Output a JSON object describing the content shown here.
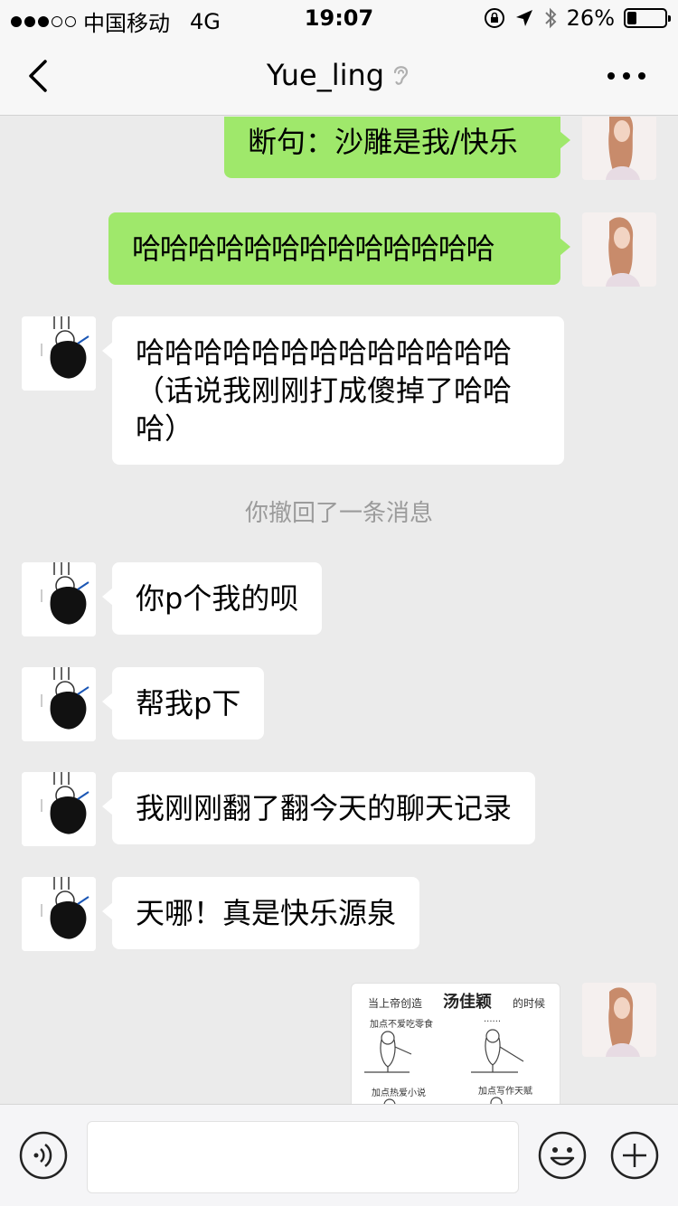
{
  "status_bar": {
    "carrier": "中国移动",
    "network": "4G",
    "time": "19:07",
    "battery": "26%",
    "battery_level": 0.26,
    "signal_bars": 3,
    "signal_total": 5,
    "icons": [
      "rotation-lock-icon",
      "location-arrow-icon",
      "bluetooth-icon",
      "battery-icon"
    ]
  },
  "nav": {
    "title": "Yue_ling",
    "back_icon": "chevron-left-icon",
    "title_icon": "ear-icon",
    "more_icon": "more-dots-icon"
  },
  "messages": [
    {
      "from": "me",
      "text": "断句：沙雕是我/快乐"
    },
    {
      "from": "me",
      "text": "哈哈哈哈哈哈哈哈哈哈哈哈哈"
    },
    {
      "from": "them",
      "text": "哈哈哈哈哈哈哈哈哈哈哈哈哈（话说我刚刚打成傻掉了哈哈哈）"
    },
    {
      "from": "system",
      "text": "你撤回了一条消息"
    },
    {
      "from": "them",
      "text": "你p个我的呗"
    },
    {
      "from": "them",
      "text": "帮我p下"
    },
    {
      "from": "them",
      "text": "我刚刚翻了翻今天的聊天记录"
    },
    {
      "from": "them",
      "text": "天哪！真是快乐源泉"
    },
    {
      "from": "me",
      "type": "sticker"
    }
  ],
  "sticker": {
    "header_left": "当上帝创造",
    "header_name": "汤佳颖",
    "header_right": "的时候",
    "cap1": "加点不爱吃零食",
    "cap2": "......",
    "cap3": "加点热爱小说",
    "cap4": "加点写作天赋"
  },
  "input_bar": {
    "value": "",
    "voice_icon": "voice-icon",
    "emoji_icon": "emoji-icon",
    "plus_icon": "plus-circle-icon"
  },
  "colors": {
    "my_bubble": "#9fe86b",
    "their_bubble": "#ffffff",
    "chat_background": "#ebebeb",
    "system_text": "#9b9b9b"
  }
}
